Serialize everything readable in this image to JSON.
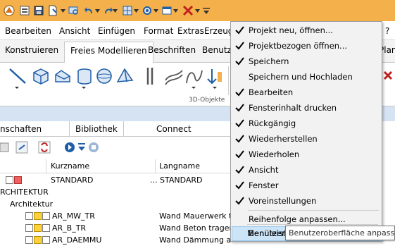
{
  "colors": {
    "toolbar_bg": "#f4b04b",
    "band_blue": "#d6e3f3",
    "menu_bg": "#f2f2f2",
    "highlight": "#cce4f7",
    "accent_blue": "#1f5fa8"
  },
  "quick_access": {
    "icons": [
      "allplan-logo-icon",
      "open-icon",
      "save-icon",
      "new-doc-icon",
      "search-icon",
      "undo-icon",
      "redo-icon",
      "layout-icon",
      "settings-icon",
      "window-icon",
      "tools-icon",
      "customize-quick-access-icon"
    ]
  },
  "menubar": {
    "items": [
      "Bearbeiten",
      "Ansicht",
      "Einfügen",
      "Format",
      "Extras",
      "Erzeug"
    ],
    "right_partial": "?"
  },
  "ribbon": {
    "tabs": [
      "Konstruieren",
      "Freies Modellieren",
      "Beschriften",
      "Benutzer"
    ],
    "active_tab": "Freies Modellieren",
    "right_partial": "Planl",
    "group_name": "3D-Objekte"
  },
  "palette": {
    "tabs": [
      "nschaften",
      "Bibliothek",
      "Connect"
    ],
    "active_tab": "Bibliothek",
    "columns": [
      "Kurzname",
      "Langname"
    ],
    "rows": [
      {
        "kurz": "STANDARD",
        "lang": "... STANDARD",
        "indent": 0,
        "squares": [
          "plain",
          "red"
        ]
      },
      {
        "kurz": "RCHITEKTUR",
        "lang": "",
        "indent": 0,
        "squares": []
      },
      {
        "kurz": "Architektur",
        "lang": "",
        "indent": 1,
        "squares": []
      },
      {
        "kurz": "AR_MW_TR",
        "lang": "Wand Mauerwerk tra",
        "indent": 2,
        "squares": [
          "plain",
          "yellow",
          "plain"
        ]
      },
      {
        "kurz": "AR_B_TR",
        "lang": "Wand Beton tragend",
        "indent": 2,
        "squares": [
          "plain",
          "yellow",
          "plain"
        ]
      },
      {
        "kurz": "AR_DAEMMU",
        "lang": "Wand Dämmung allg",
        "indent": 2,
        "squares": [
          "plain",
          "yellow",
          "plain"
        ]
      }
    ]
  },
  "dropdown": {
    "items": [
      {
        "label": "Projekt neu, öffnen...",
        "checked": true
      },
      {
        "label": "Projektbezogen öffnen...",
        "checked": true
      },
      {
        "label": "Speichern",
        "checked": true
      },
      {
        "label": "Speichern und Hochladen",
        "checked": false
      },
      {
        "label": "Bearbeiten",
        "checked": true
      },
      {
        "label": "Fensterinhalt drucken",
        "checked": true
      },
      {
        "label": "Rückgängig",
        "checked": true
      },
      {
        "label": "Wiederherstellen",
        "checked": true
      },
      {
        "label": "Wiederholen",
        "checked": true
      },
      {
        "label": "Ansicht",
        "checked": true
      },
      {
        "label": "Fenster",
        "checked": true
      },
      {
        "label": "Voreinstellungen",
        "checked": true
      }
    ],
    "reorder": "Reihenfolge anpassen...",
    "customize": "Benutzeroberfläche anpassen...",
    "bottom": "Menüleiste"
  },
  "tooltip": "Benutzeroberfläche anpassen"
}
